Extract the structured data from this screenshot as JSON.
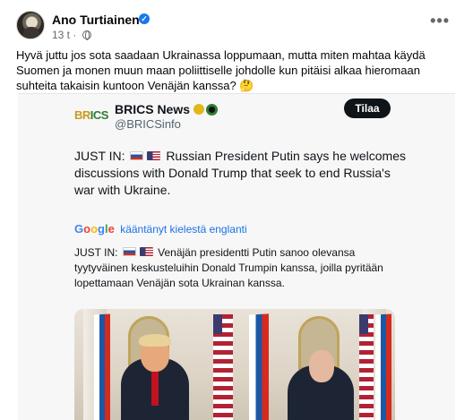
{
  "post": {
    "author": "Ano Turtiainen",
    "time": "13 t",
    "separator": "·",
    "more_label": "•••",
    "verified_mark": "✓",
    "text": "Hyvä juttu jos sota saadaan Ukrainassa loppumaan, mutta miten mahtaa käydä Suomen ja monen muun maan poliittiselle johdolle kun pitäisi alkaa hieromaan suhteita takaisin kuntoon Venäjän kanssa? 🤔"
  },
  "tweet": {
    "logo_text_1": "BR",
    "logo_text_2": "ICS",
    "display_name": "BRICS News",
    "handle": "@BRICSinfo",
    "follow_label": "Tilaa",
    "text_prefix": "JUST IN:",
    "text_body": "Russian President Putin says he welcomes discussions with Donald Trump that seek to end Russia's war with Ukraine.",
    "translate_note": "kääntänyt kielestä englanti",
    "translated_prefix": "JUST IN:",
    "translated_body": "Venäjän presidentti Putin sanoo olevansa tyytyväinen keskusteluihin Donald Trumpin kanssa, joilla pyritään lopettamaan Venäjän sota Ukrainan kanssa."
  },
  "google": {
    "g1": "G",
    "g2": "o",
    "g3": "o",
    "g4": "g",
    "g5": "l",
    "g6": "e"
  },
  "colors": {
    "accent": "#1877f2",
    "translate_link": "#1a73e8",
    "follow_bg": "#0f1419"
  }
}
